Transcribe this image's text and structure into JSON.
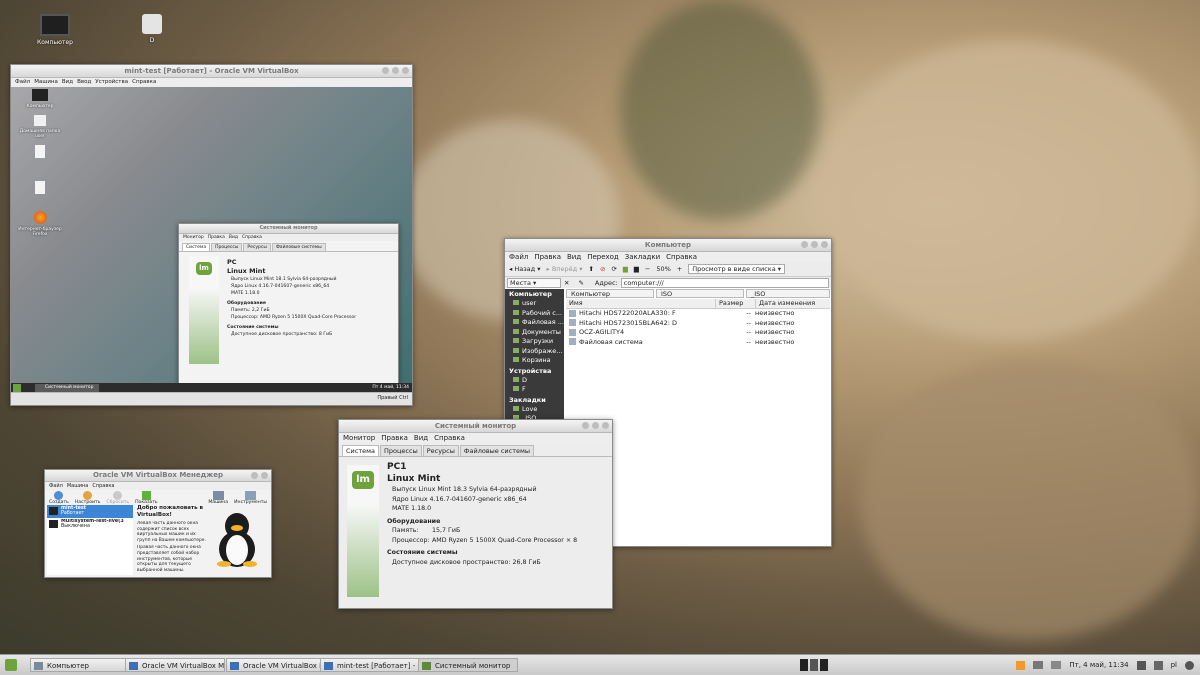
{
  "desktop": {
    "icons": [
      {
        "label": "Компьютер"
      },
      {
        "label": "D"
      }
    ]
  },
  "vm_window": {
    "title": "mint-test [Работает] - Oracle VM VirtualBox",
    "menu": [
      "Файл",
      "Машина",
      "Вид",
      "Ввод",
      "Устройства",
      "Справка"
    ],
    "guest_icons": [
      "Компьютер",
      "Домашняя папка user",
      "",
      "",
      "Интернет-браузер Firefox"
    ],
    "guest_sysmon": {
      "title": "Системный монитор",
      "menu": [
        "Монитор",
        "Правка",
        "Вид",
        "Справка"
      ],
      "tabs": [
        "Система",
        "Процессы",
        "Ресурсы",
        "Файловые системы"
      ],
      "host": "PC",
      "os": "Linux Mint",
      "release": "Выпуск Linux Mint 18.1 Sylvia 64-разрядный",
      "kernel": "Ядро Linux 4.16.7-041607-generic x86_64",
      "mate": "MATE 1.18.0",
      "hw_hdr": "Оборудование",
      "mem": "Память:        2,2 ГиБ",
      "cpu": "Процессор:  AMD Ryzen 5 1500X Quad-Core Processor",
      "state_hdr": "Состояние системы",
      "disk": "Доступное дисковое пространство: 8 ГиБ"
    },
    "guest_taskbar": {
      "task": "Системный монитор",
      "clock": "Пт 4 май, 11:34",
      "status": "Правый Ctrl"
    }
  },
  "caja": {
    "title": "Компьютер",
    "menu": [
      "Файл",
      "Правка",
      "Вид",
      "Переход",
      "Закладки",
      "Справка"
    ],
    "toolbar": {
      "back": "Назад",
      "forward": "Вперёд",
      "zoom": "50%",
      "view": "Просмотр в виде списка"
    },
    "places_label": "Места",
    "address_label": "Адрес:",
    "address": "computer:///",
    "crumbs": [
      "Компьютер",
      "ISO",
      "_ISO"
    ],
    "columns": [
      "Имя",
      "Размер",
      "Дата изменения"
    ],
    "rows": [
      {
        "name": "Hitachi HDS722020ALA330: F",
        "size": "--",
        "date": "неизвестно"
      },
      {
        "name": "Hitachi HDS723015BLA642: D",
        "size": "--",
        "date": "неизвестно"
      },
      {
        "name": "OCZ-AGILITY4",
        "size": "--",
        "date": "неизвестно"
      },
      {
        "name": "Файловая система",
        "size": "--",
        "date": "неизвестно"
      }
    ],
    "sidebar": {
      "computer_hdr": "Компьютер",
      "computer": [
        "user",
        "Рабочий с...",
        "Файловая ...",
        "Документы",
        "Загрузки",
        "Изображе...",
        "Корзина"
      ],
      "devices_hdr": "Устройства",
      "devices": [
        "D",
        "F"
      ],
      "bookmarks_hdr": "Закладки",
      "bookmarks": [
        "Love",
        "_ISO"
      ]
    }
  },
  "sysmon": {
    "title": "Системный монитор",
    "menu": [
      "Монитор",
      "Правка",
      "Вид",
      "Справка"
    ],
    "tabs": [
      "Система",
      "Процессы",
      "Ресурсы",
      "Файловые системы"
    ],
    "host": "PC1",
    "os": "Linux Mint",
    "release": "Выпуск Linux Mint 18.3 Sylvia 64-разрядный",
    "kernel": "Ядро Linux 4.16.7-041607-generic x86_64",
    "mate": "MATE 1.18.0",
    "hw_hdr": "Оборудование",
    "mem_label": "Память:",
    "mem_val": "15,7 ГиБ",
    "cpu_label": "Процессор:",
    "cpu_val": "AMD Ryzen 5 1500X Quad-Core Processor × 8",
    "state_hdr": "Состояние системы",
    "disk": "Доступное дисковое пространство: 26,8 ГиБ"
  },
  "vbox_manager": {
    "title": "Oracle VM VirtualBox Менеджер",
    "menu": [
      "Файл",
      "Машина",
      "Справка"
    ],
    "tools": [
      "Создать",
      "Настроить",
      "Сбросить",
      "Показать"
    ],
    "right_tools": [
      "Машина",
      "Инструменты"
    ],
    "vms": [
      {
        "name": "mint-test",
        "state": "Работает"
      },
      {
        "name": "Multisystem-Test-live(3",
        "state": "Выключена"
      }
    ],
    "welcome_title": "Добро пожаловать в VirtualBox!",
    "welcome_text": "Левая часть данного окна содержит список всех виртуальных машин и их групп на Вашем компьютере.",
    "welcome_text2": "Правая часть данного окна представляет собой набор инструментов, которые открыты для текущего выбранной машины."
  },
  "taskbar": {
    "tasks": [
      "Компьютер",
      "Oracle VM VirtualBox Мен...",
      "Oracle VM VirtualBox Мен...",
      "mint-test [Работает] - Or...",
      "Системный монитор"
    ],
    "clock": "Пт, 4 май, 11:34",
    "lang": "pl"
  }
}
